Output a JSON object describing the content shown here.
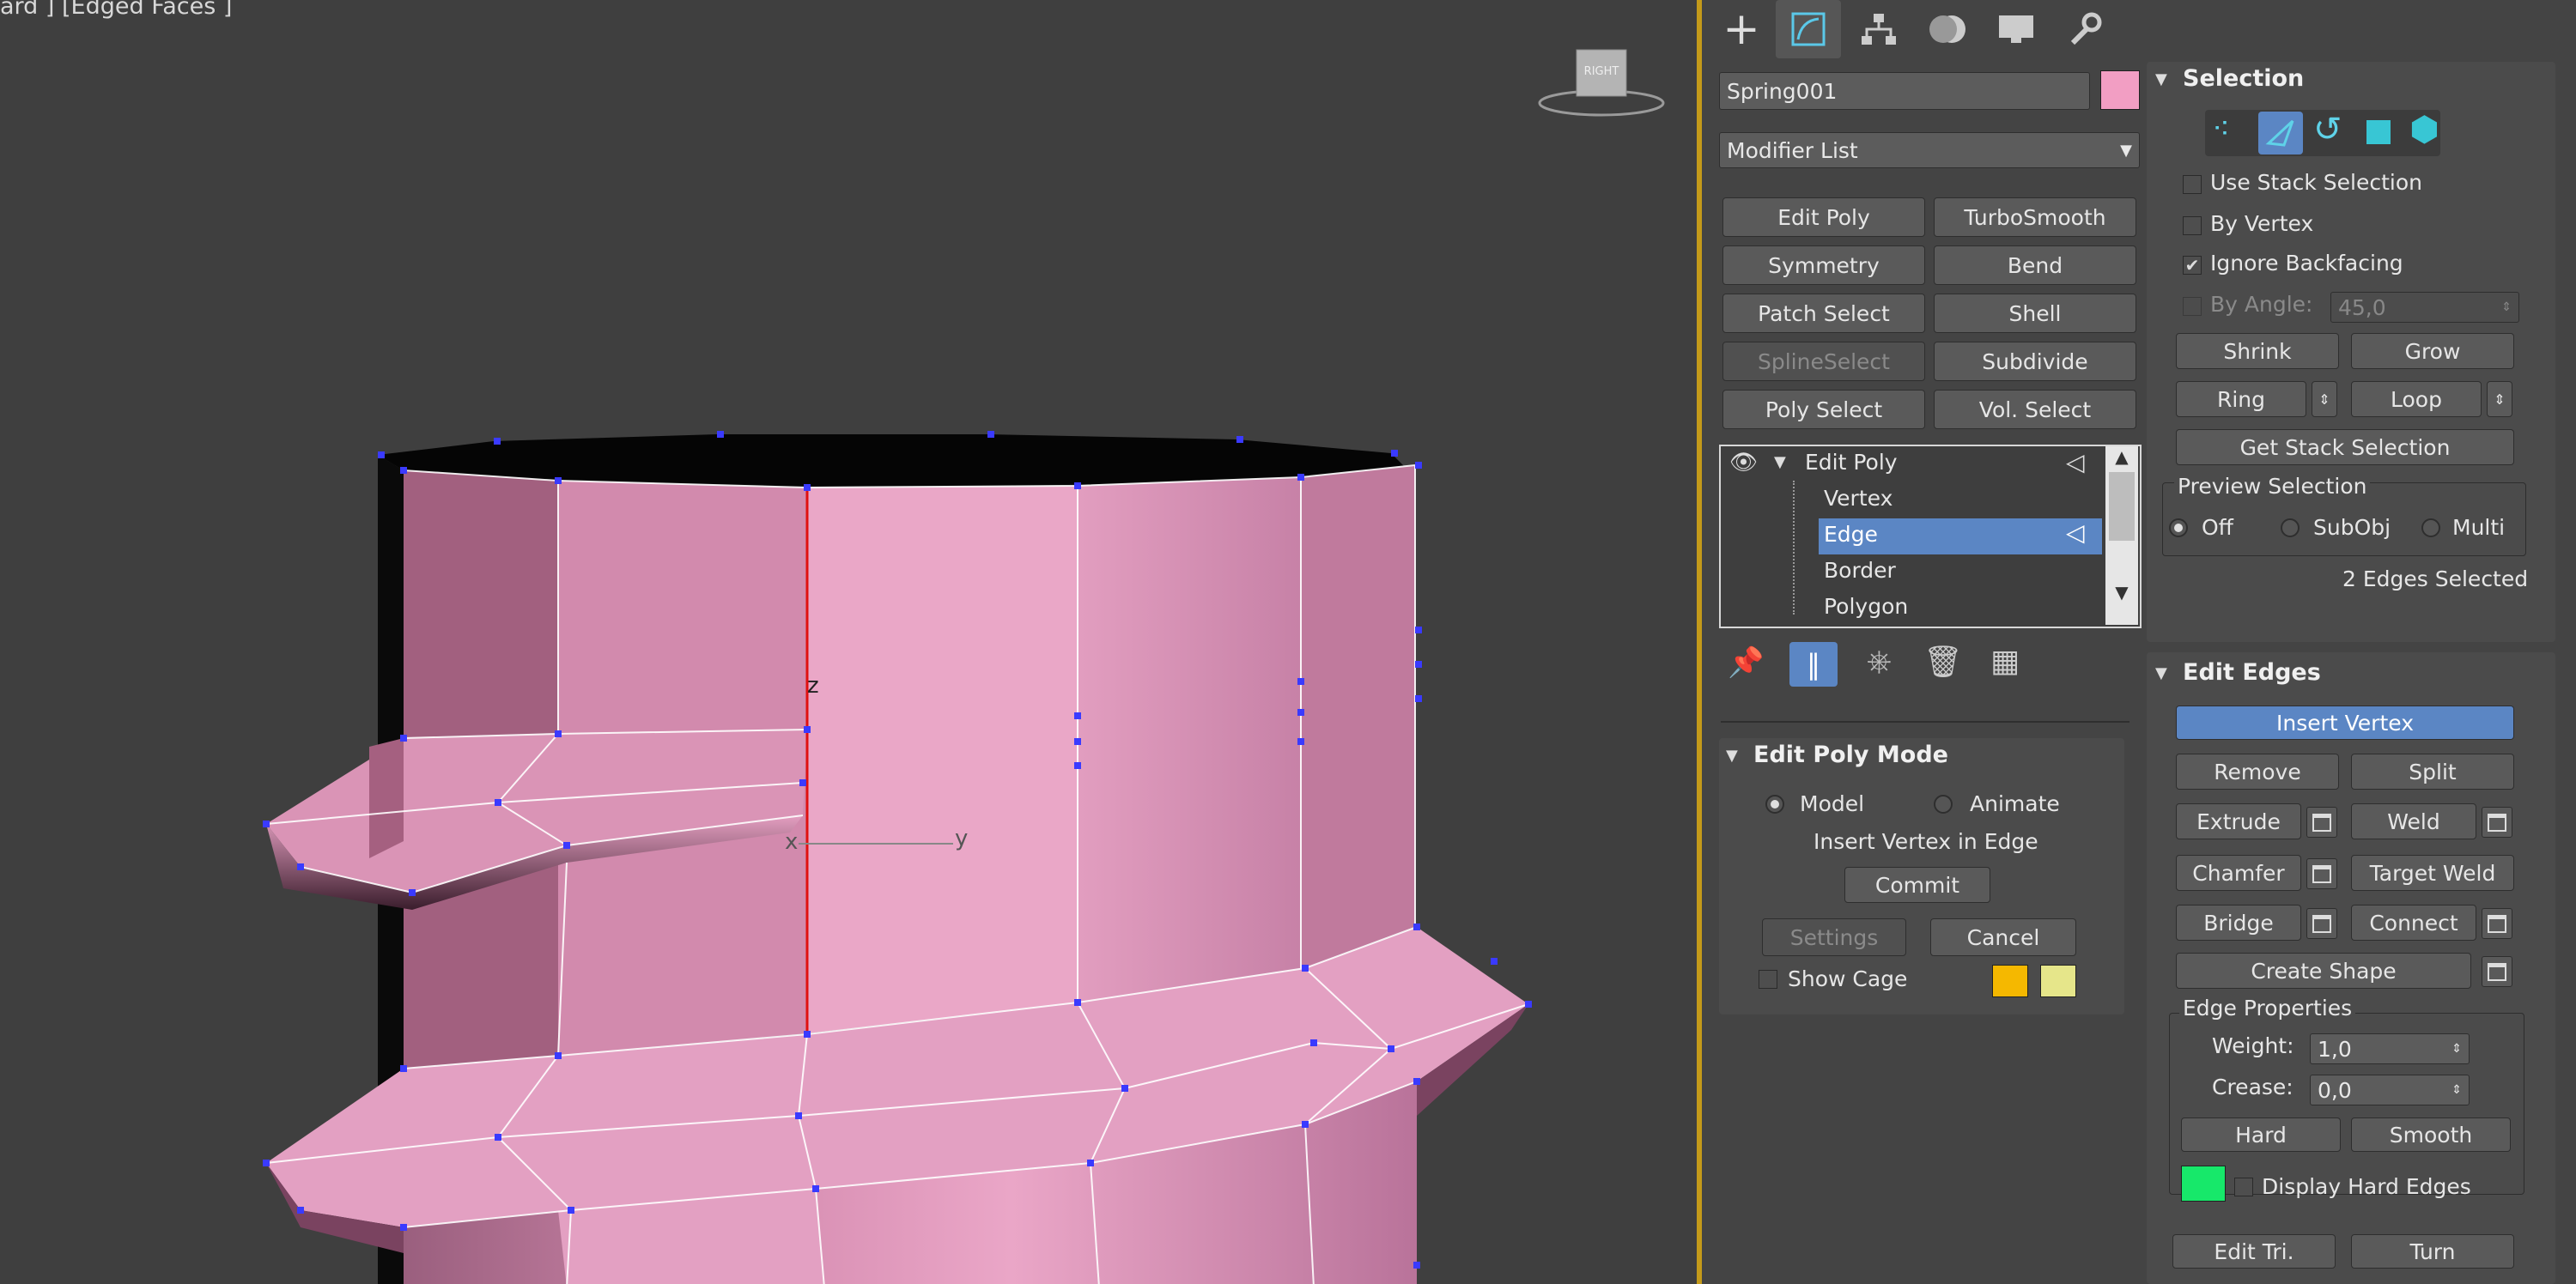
{
  "viewport": {
    "label": "ard ] [Edged Faces ]",
    "viewcube_label": "RIGHT",
    "gizmo": {
      "x": "x",
      "y": "y",
      "z": "z"
    }
  },
  "command_panel": {
    "tabs": [
      "create-icon",
      "modify-icon",
      "hierarchy-icon",
      "motion-icon",
      "display-icon",
      "utilities-icon"
    ],
    "object_name": "Spring001",
    "object_color": "#f29ec3",
    "modifier_list": "Modifier List",
    "modifier_buttons": [
      "Edit Poly",
      "TurboSmooth",
      "Symmetry",
      "Bend",
      "Patch Select",
      "Shell",
      "SplineSelect",
      "Subdivide",
      "Poly Select",
      "Vol. Select"
    ],
    "stack": {
      "root": "Edit Poly",
      "items": [
        "Vertex",
        "Edge",
        "Border",
        "Polygon"
      ],
      "selected": "Edge"
    },
    "edit_poly_mode": {
      "title": "Edit Poly Mode",
      "model": "Model",
      "animate": "Animate",
      "operation": "Insert Vertex in Edge",
      "commit": "Commit",
      "settings": "Settings",
      "cancel": "Cancel",
      "show_cage": "Show Cage",
      "cage_colors": [
        "#f5b800",
        "#e6e68a"
      ]
    },
    "selection": {
      "title": "Selection",
      "use_stack": "Use Stack Selection",
      "by_vertex": "By Vertex",
      "ignore_backfacing": "Ignore Backfacing",
      "by_angle": "By Angle:",
      "angle_value": "45,0",
      "shrink": "Shrink",
      "grow": "Grow",
      "ring": "Ring",
      "loop": "Loop",
      "get_stack": "Get Stack Selection",
      "preview_title": "Preview Selection",
      "preview_off": "Off",
      "preview_subobj": "SubObj",
      "preview_multi": "Multi",
      "status": "2 Edges Selected"
    },
    "edit_edges": {
      "title": "Edit Edges",
      "insert_vertex": "Insert Vertex",
      "remove": "Remove",
      "split": "Split",
      "extrude": "Extrude",
      "weld": "Weld",
      "chamfer": "Chamfer",
      "target_weld": "Target Weld",
      "bridge": "Bridge",
      "connect": "Connect",
      "create_shape": "Create Shape",
      "edge_props": "Edge Properties",
      "weight_label": "Weight:",
      "weight": "1,0",
      "crease_label": "Crease:",
      "crease": "0,0",
      "hard": "Hard",
      "smooth": "Smooth",
      "hard_color": "#17e86a",
      "display_hard": "Display Hard Edges",
      "edit_tri": "Edit Tri.",
      "turn": "Turn"
    }
  }
}
